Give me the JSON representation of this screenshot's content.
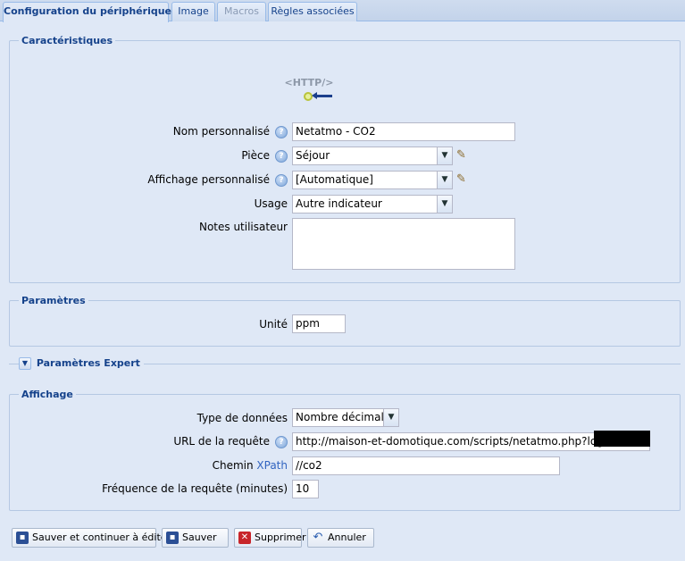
{
  "tabs": [
    {
      "label": "Configuration du périphérique",
      "state": "active"
    },
    {
      "label": "Image",
      "state": "normal"
    },
    {
      "label": "Macros",
      "state": "disabled"
    },
    {
      "label": "Règles associées",
      "state": "normal"
    }
  ],
  "caracteristiques": {
    "legend": "Caractéristiques",
    "device_icon_text": "<HTTP/>",
    "nom_label": "Nom personnalisé",
    "nom_value": "Netatmo - CO2",
    "piece_label": "Pièce",
    "piece_value": "Séjour",
    "affichage_label": "Affichage personnalisé",
    "affichage_value": "[Automatique]",
    "usage_label": "Usage",
    "usage_value": "Autre indicateur",
    "notes_label": "Notes utilisateur",
    "notes_value": ""
  },
  "parametres": {
    "legend": "Paramètres",
    "unite_label": "Unité",
    "unite_value": "ppm"
  },
  "expert": {
    "label": "Paramètres Expert"
  },
  "affichage": {
    "legend": "Affichage",
    "type_label": "Type de données",
    "type_value": "Nombre décimal",
    "url_label": "URL de la requête",
    "url_value": "http://maison-et-domotique.com/scripts/netatmo.php?login=",
    "chemin_label": "Chemin",
    "chemin_link": "XPath",
    "chemin_value": "//co2",
    "freq_label": "Fréquence de la requête (minutes)",
    "freq_value": "10"
  },
  "buttons": {
    "save_continue": "Sauver et continuer à éditer",
    "save": "Sauver",
    "delete": "Supprimer",
    "cancel": "Annuler"
  },
  "colors": {
    "accent": "#15428b",
    "background": "#dfe8f6"
  }
}
